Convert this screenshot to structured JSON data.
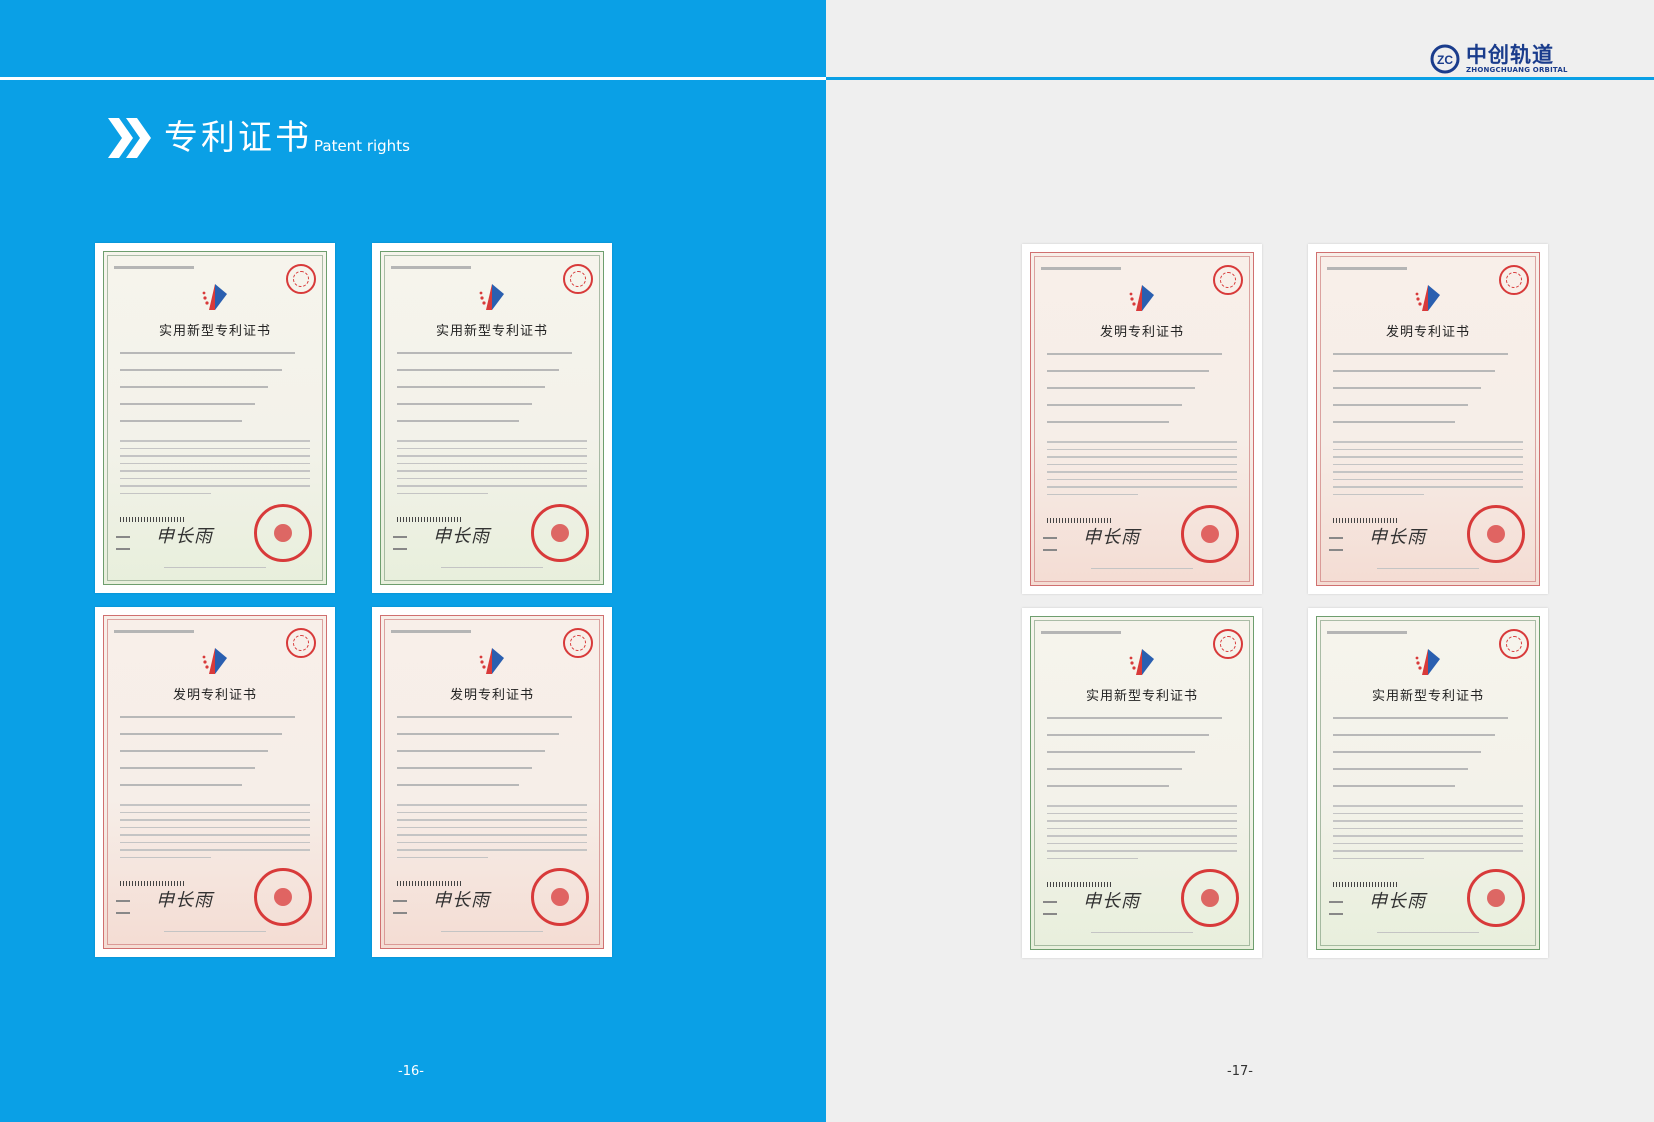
{
  "section": {
    "title_cn": "专利证书",
    "title_en": "Patent rights"
  },
  "logo": {
    "name_cn": "中创轨道",
    "name_en": "ZHONGCHUANG ORBITAL",
    "mark": "ZC"
  },
  "pages": {
    "left_number": "-16-",
    "right_number": "-17-"
  },
  "certificates": [
    {
      "title": "实用新型专利证书",
      "border_color": "green"
    },
    {
      "title": "实用新型专利证书",
      "border_color": "green"
    },
    {
      "title": "发明专利证书",
      "border_color": "red"
    },
    {
      "title": "发明专利证书",
      "border_color": "red"
    },
    {
      "title": "发明专利证书",
      "border_color": "red"
    },
    {
      "title": "发明专利证书",
      "border_color": "red"
    },
    {
      "title": "实用新型专利证书",
      "border_color": "green"
    },
    {
      "title": "实用新型专利证书",
      "border_color": "green"
    }
  ],
  "colors": {
    "page_blue": "#0aa0e6",
    "logo_navy": "#1a3c8c",
    "seal_red": "#d83a3a"
  }
}
